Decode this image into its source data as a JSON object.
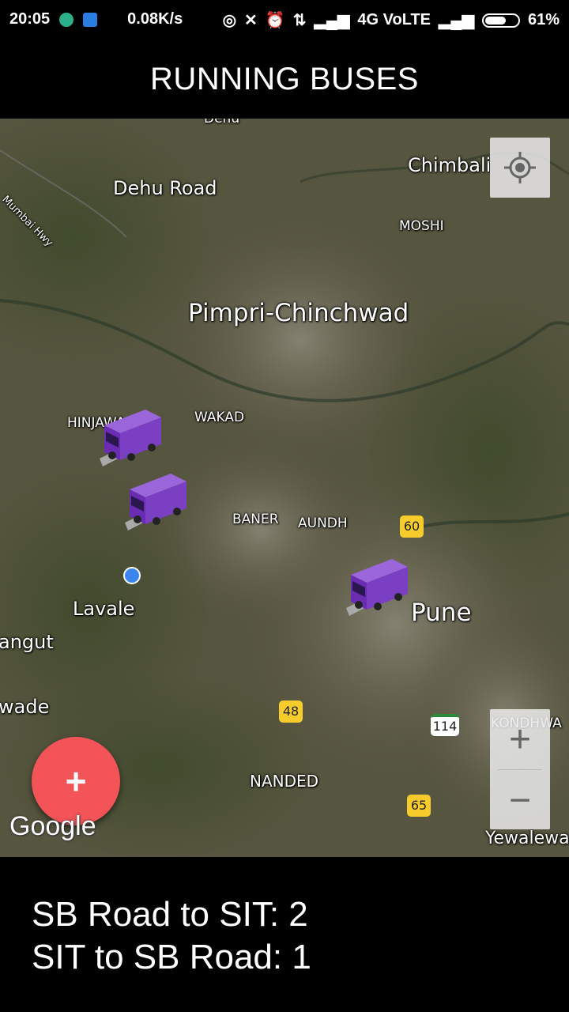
{
  "status": {
    "time": "20:05",
    "net_speed": "0.08K/s",
    "network": "4G VoLTE",
    "battery": "61%"
  },
  "appbar": {
    "title": "RUNNING BUSES"
  },
  "map": {
    "labels": {
      "dehu": "Dehu",
      "mumbai_hwy": "Mumbai Hwy",
      "dehu_road": "Dehu Road",
      "chimbali": "Chimbali",
      "moshi": "MOSHI",
      "pimpri": "Pimpri-Chinchwad",
      "hinjawadi": "HINJAWA",
      "wakad": "WAKAD",
      "baner": "BANER",
      "aundh": "AUNDH",
      "lavale": "Lavale",
      "pune": "Pune",
      "angut": "angut",
      "wade": "wade",
      "nanded": "NANDED",
      "kondhwa": "KONDHWA",
      "yewalewa": "Yewalewa"
    },
    "shields": {
      "s60": "60",
      "s48": "48",
      "s114": "114",
      "s65": "65"
    },
    "buses_shown": 3,
    "attribution": "Google",
    "zoom_in": "+",
    "zoom_out": "−",
    "fab_label": "+"
  },
  "routes": [
    {
      "text": "SB Road to SIT: 2"
    },
    {
      "text": "SIT to SB Road: 1"
    }
  ],
  "colors": {
    "fab": "#f25458",
    "bus": "#7a3fc2",
    "my_location": "#3d86f0"
  }
}
